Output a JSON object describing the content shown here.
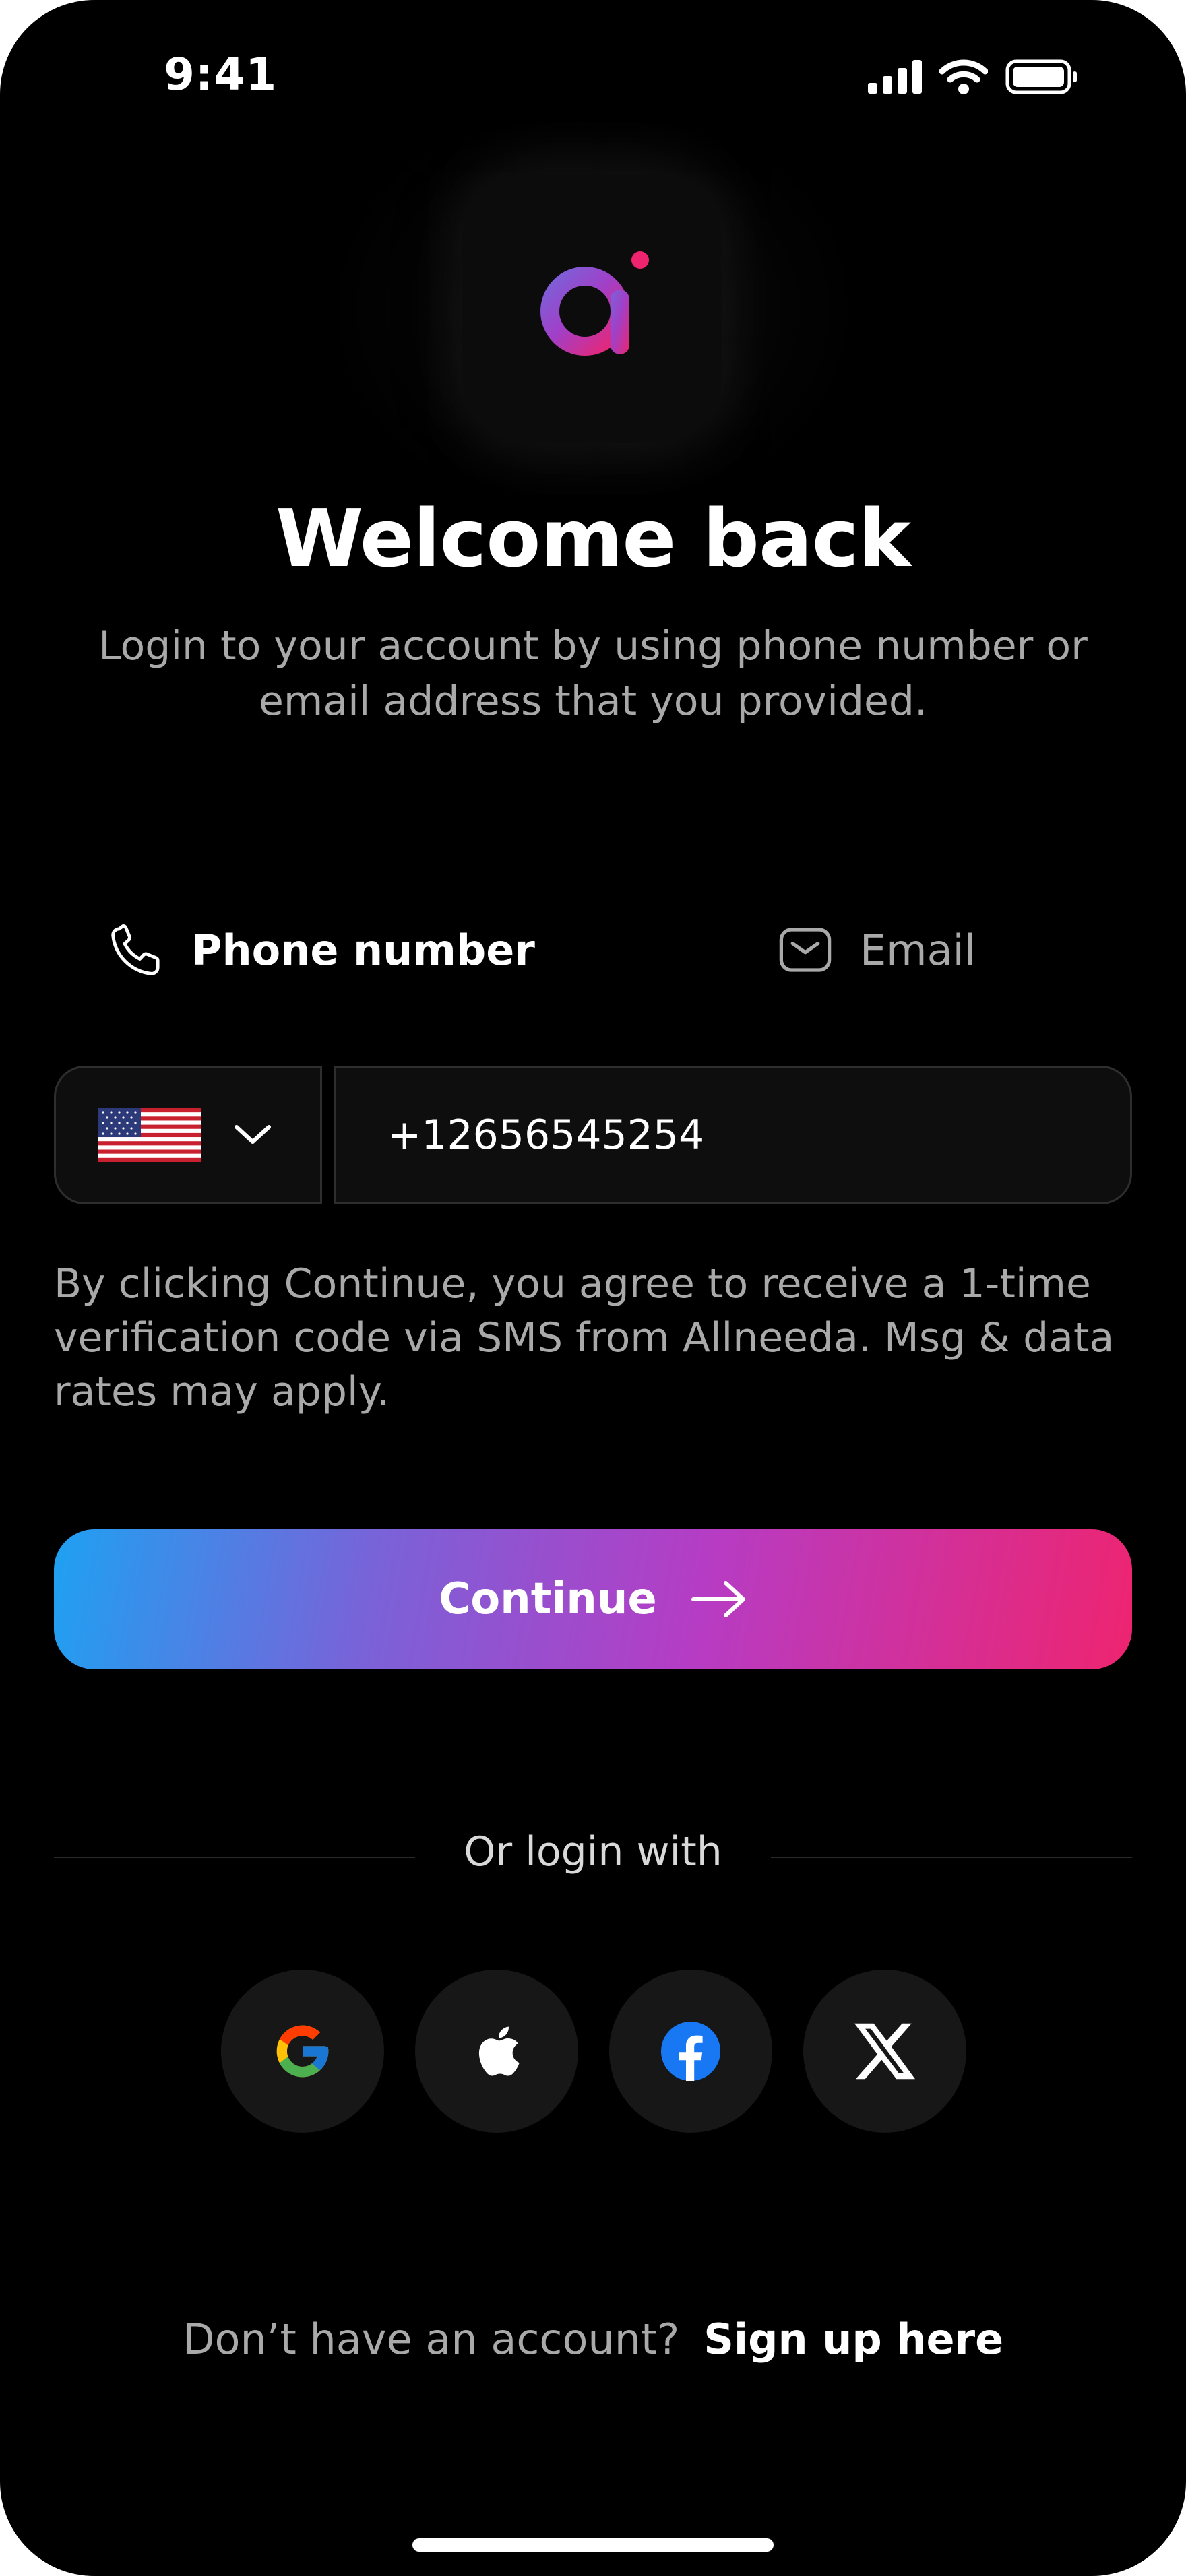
{
  "status_bar": {
    "time": "9:41"
  },
  "header": {
    "title": "Welcome back",
    "subtitle": "Login to your account by using phone number or email address that you provided."
  },
  "tabs": [
    {
      "label": "Phone number",
      "active": true
    },
    {
      "label": "Email",
      "active": false
    }
  ],
  "phone_form": {
    "phone_value": "+12656545254"
  },
  "legal_text": "By clicking Continue, you agree to receive a 1-time verification code via SMS from Allneeda. Msg & data rates may apply.",
  "continue_label": "Continue",
  "social": {
    "divider_label": "Or login with",
    "providers": [
      "google-icon",
      "apple-icon",
      "facebook-icon",
      "x-icon"
    ]
  },
  "footer": {
    "question": "Don’t have an account?",
    "link": "Sign up here"
  },
  "colors": {
    "background": "#000000",
    "gradient_start": "#1ea1f2",
    "gradient_mid": "#b63cc4",
    "gradient_end": "#ee2470",
    "muted_text": "#a9a9a9"
  }
}
